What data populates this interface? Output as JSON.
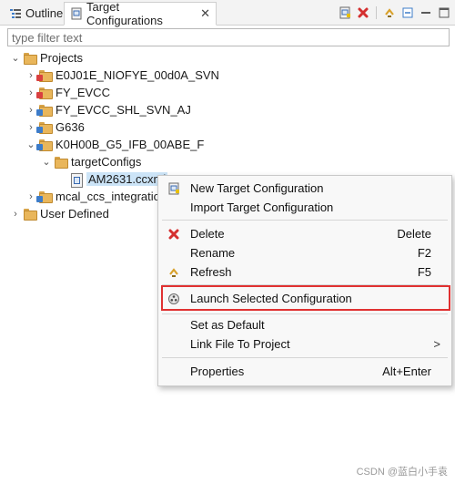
{
  "tabs": [
    {
      "label": "Outline",
      "icon": "outline-icon"
    },
    {
      "label": "Target Configurations",
      "icon": "target-config-icon",
      "close": "✕"
    }
  ],
  "filter": {
    "placeholder": "type filter text",
    "value": ""
  },
  "tree": {
    "projects_label": "Projects",
    "projects": [
      {
        "label": "E0J01E_NIOFYE_00d0A_SVN",
        "expanded": false
      },
      {
        "label": "FY_EVCC",
        "expanded": false
      },
      {
        "label": "FY_EVCC_SHL_SVN_AJ",
        "expanded": false
      },
      {
        "label": "G636",
        "expanded": false
      },
      {
        "label": "K0H00B_G5_IFB_00ABE_F",
        "expanded": true
      },
      {
        "label": "mcal_ccs_integratio",
        "expanded": false
      }
    ],
    "subfolder_label": "targetConfigs",
    "file_label": "AM2631.ccxml",
    "user_defined_label": "User Defined"
  },
  "context_menu": {
    "new_target": "New Target Configuration",
    "import_target": "Import Target Configuration",
    "delete": "Delete",
    "delete_key": "Delete",
    "rename": "Rename",
    "rename_key": "F2",
    "refresh": "Refresh",
    "refresh_key": "F5",
    "launch": "Launch Selected Configuration",
    "set_default": "Set as Default",
    "link_file": "Link File To Project",
    "link_arrow": ">",
    "properties": "Properties",
    "properties_key": "Alt+Enter"
  },
  "watermark": "CSDN @蓝白小手袁",
  "colors": {
    "highlight_box": "#e03131",
    "selection": "#cce4f7",
    "delete_icon": "#d42f2f"
  }
}
